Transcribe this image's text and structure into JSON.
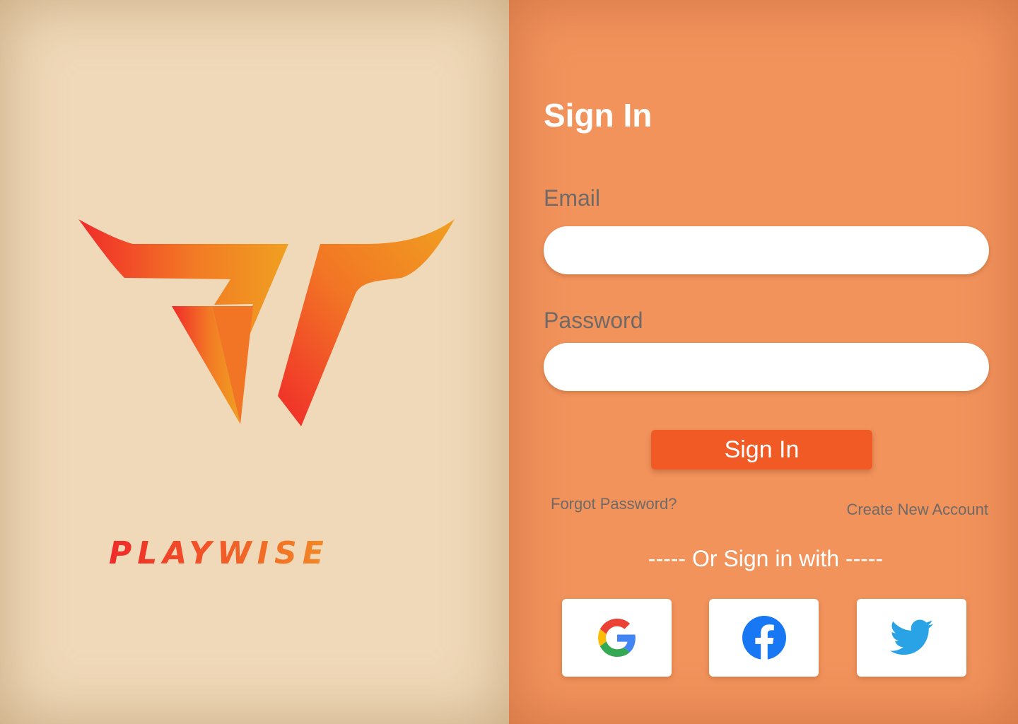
{
  "brand": {
    "wordmark": "PLAYWISE"
  },
  "signin": {
    "title": "Sign In",
    "email_label": "Email",
    "email_value": "",
    "password_label": "Password",
    "password_value": "",
    "button_label": "Sign In",
    "forgot_link": "Forgot Password?",
    "create_link": "Create New Account",
    "divider": "----- Or Sign in with -----"
  },
  "social": [
    {
      "provider": "Google",
      "icon": "google-icon"
    },
    {
      "provider": "Facebook",
      "icon": "facebook-icon"
    },
    {
      "provider": "Twitter",
      "icon": "twitter-icon"
    }
  ],
  "colors": {
    "left_background": "#f0d9b9",
    "right_background": "#f2935c",
    "primary_button": "#f15a24",
    "label_text": "#6f6a67",
    "logo_gradient": [
      "#f02a2a",
      "#f0a020"
    ]
  }
}
